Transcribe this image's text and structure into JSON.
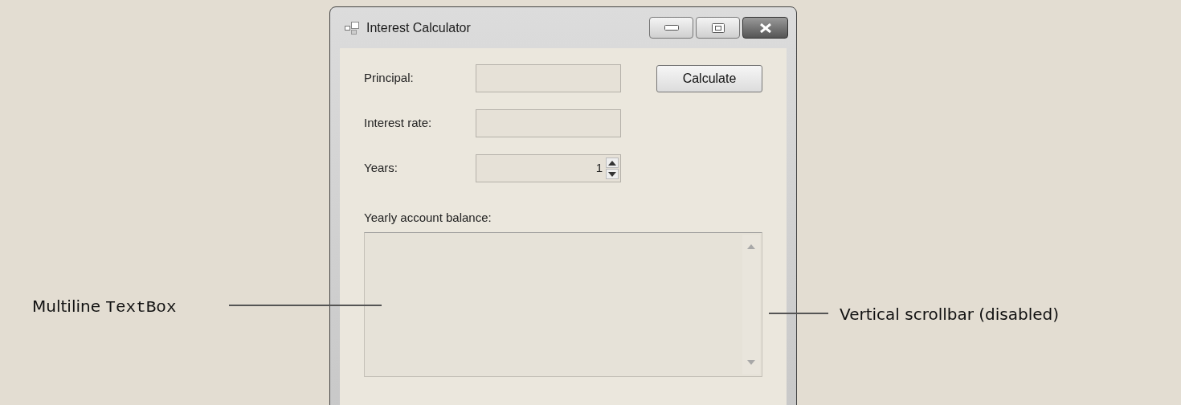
{
  "window": {
    "title": "Interest Calculator"
  },
  "fields": [
    {
      "kind": "text",
      "label": "Principal:"
    },
    {
      "kind": "text",
      "label": "Interest rate:"
    },
    {
      "kind": "spinner",
      "label": "Years:",
      "value": "1"
    }
  ],
  "calculate_button": {
    "label": "Calculate"
  },
  "balance": {
    "label": "Yearly account balance:",
    "scrollbar": {
      "disabled": true
    }
  },
  "callouts": [
    {
      "kind": "left",
      "text": "Multiline",
      "code": "TextBox"
    },
    {
      "kind": "right",
      "text": "Vertical scrollbar (disabled)"
    }
  ]
}
